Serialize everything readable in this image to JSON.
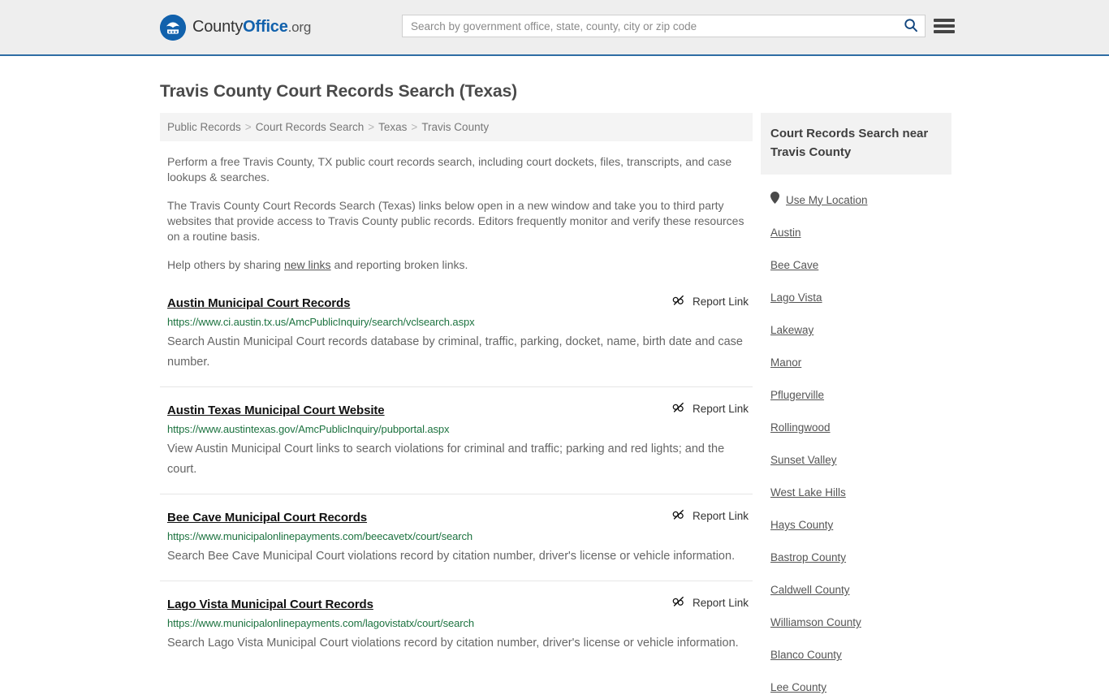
{
  "header": {
    "brand": {
      "part1": "County",
      "part2": "Office",
      "part3": ".org",
      "logo_icon": "eagle-stars-emblem"
    },
    "search": {
      "placeholder": "Search by government office, state, county, city or zip code",
      "value": "",
      "search_icon": "search-icon"
    },
    "menu_icon": "hamburger-menu-icon",
    "accent_color": "#2e6da4",
    "background_color": "#eeeeee"
  },
  "page": {
    "title": "Travis County Court Records Search (Texas)",
    "breadcrumb": [
      {
        "label": "Public Records"
      },
      {
        "label": "Court Records Search"
      },
      {
        "label": "Texas"
      },
      {
        "label": "Travis County"
      }
    ],
    "breadcrumb_separator": ">",
    "intro": {
      "p1": "Perform a free Travis County, TX public court records search, including court dockets, files, transcripts, and case lookups & searches.",
      "p2": "The Travis County Court Records Search (Texas) links below open in a new window and take you to third party websites that provide access to Travis County public records. Editors frequently monitor and verify these resources on a routine basis.",
      "p3_before": "Help others by sharing ",
      "p3_link": "new links",
      "p3_after": " and reporting broken links."
    }
  },
  "results": {
    "report_label": "Report Link",
    "report_icon": "broken-link-icon",
    "url_color": "#1d7340",
    "items": [
      {
        "title": "Austin Municipal Court Records",
        "url": "https://www.ci.austin.tx.us/AmcPublicInquiry/search/vclsearch.aspx",
        "description": "Search Austin Municipal Court records database by criminal, traffic, parking, docket, name, birth date and case number."
      },
      {
        "title": "Austin Texas Municipal Court Website",
        "url": "https://www.austintexas.gov/AmcPublicInquiry/pubportal.aspx",
        "description": "View Austin Municipal Court links to search violations for criminal and traffic; parking and red lights; and the court."
      },
      {
        "title": "Bee Cave Municipal Court Records",
        "url": "https://www.municipalonlinepayments.com/beecavetx/court/search",
        "description": "Search Bee Cave Municipal Court violations record by citation number, driver's license or vehicle information."
      },
      {
        "title": "Lago Vista Municipal Court Records",
        "url": "https://www.municipalonlinepayments.com/lagovistatx/court/search",
        "description": "Search Lago Vista Municipal Court violations record by citation number, driver's license or vehicle information."
      }
    ]
  },
  "sidebar": {
    "heading": "Court Records Search near Travis County",
    "geo": {
      "label": "Use My Location",
      "icon": "map-pin-icon"
    },
    "links": [
      {
        "label": "Austin"
      },
      {
        "label": "Bee Cave"
      },
      {
        "label": "Lago Vista"
      },
      {
        "label": "Lakeway"
      },
      {
        "label": "Manor"
      },
      {
        "label": "Pflugerville"
      },
      {
        "label": "Rollingwood"
      },
      {
        "label": "Sunset Valley"
      },
      {
        "label": "West Lake Hills"
      },
      {
        "label": "Hays County"
      },
      {
        "label": "Bastrop County"
      },
      {
        "label": "Caldwell County"
      },
      {
        "label": "Williamson County"
      },
      {
        "label": "Blanco County"
      },
      {
        "label": "Lee County"
      }
    ]
  }
}
